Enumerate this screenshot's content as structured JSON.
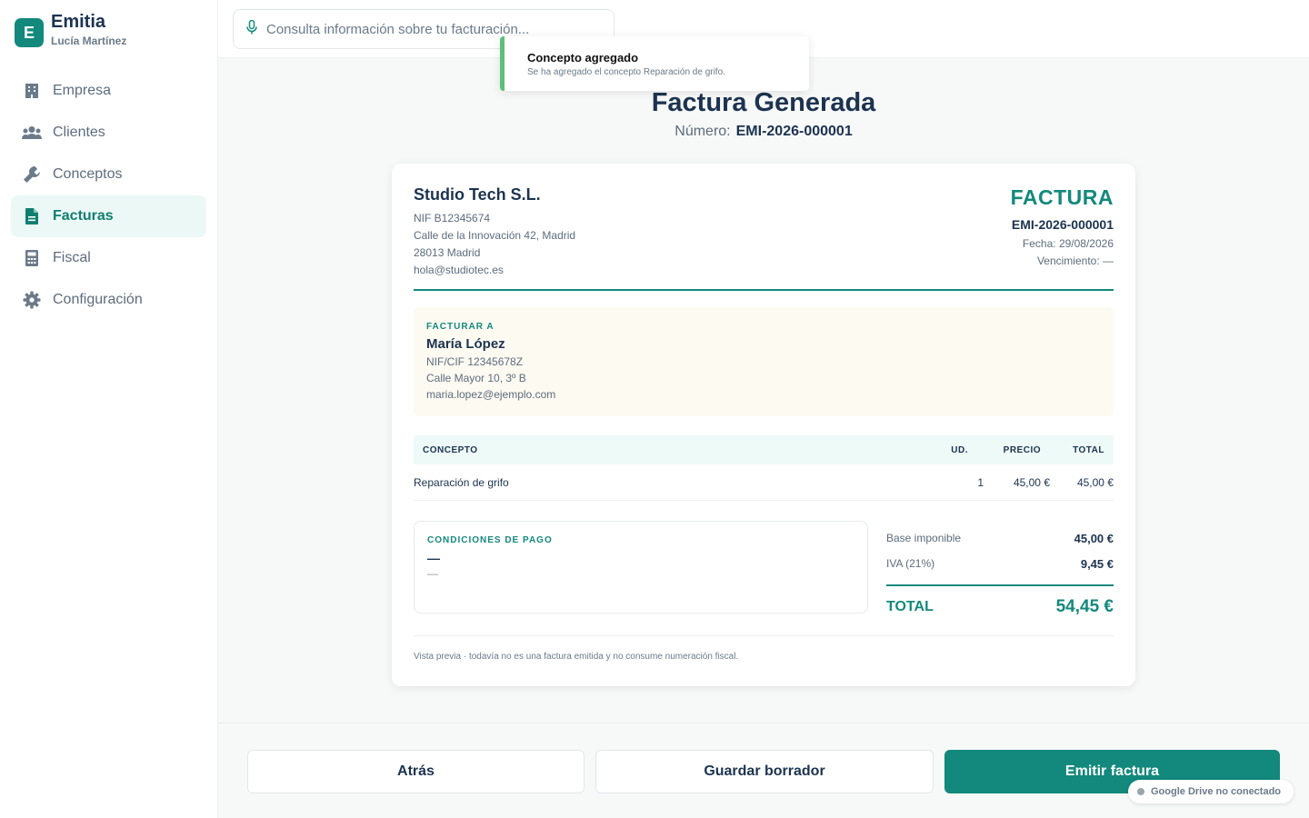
{
  "brand": {
    "logo_letter": "E",
    "name": "Emitia",
    "user": "Lucía Martínez",
    "accent": "#12897c"
  },
  "sidebar": {
    "items": [
      {
        "label": "Empresa",
        "icon": "building-icon"
      },
      {
        "label": "Clientes",
        "icon": "users-icon"
      },
      {
        "label": "Conceptos",
        "icon": "wrench-icon"
      },
      {
        "label": "Facturas",
        "icon": "document-icon",
        "active": true
      },
      {
        "label": "Fiscal",
        "icon": "calculator-icon"
      },
      {
        "label": "Configuración",
        "icon": "gear-icon"
      }
    ]
  },
  "search": {
    "placeholder": "Consulta información sobre tu facturación...",
    "icon": "microphone-icon"
  },
  "toast": {
    "title": "Concepto agregado",
    "message": "Se ha agregado el concepto Reparación de grifo.",
    "color": "#5cbf7a"
  },
  "header": {
    "title": "Factura Generada",
    "number_label": "Número:",
    "number": "EMI-2026-000001"
  },
  "invoice": {
    "issuer": {
      "name": "Studio Tech S.L.",
      "nif": "NIF B12345674",
      "address": "Calle de la Innovación 42, Madrid",
      "postal": "28013 Madrid",
      "email": "hola@studiotec.es"
    },
    "heading": "FACTURA",
    "number": "EMI-2026-000001",
    "date": "Fecha: 29/08/2026",
    "due": "Vencimiento: —",
    "client": {
      "label": "FACTURAR A",
      "name": "María López",
      "nif": "NIF/CIF 12345678Z",
      "address": "Calle Mayor 10, 3º B",
      "email": "maria.lopez@ejemplo.com"
    },
    "table": {
      "headers": {
        "concept": "CONCEPTO",
        "units": "UD.",
        "price": "PRECIO",
        "total": "TOTAL"
      },
      "rows": [
        {
          "concept": "Reparación de grifo",
          "units": "1",
          "price": "45,00 €",
          "total": "45,00 €"
        }
      ]
    },
    "conditions": {
      "label": "CONDICIONES DE PAGO",
      "main": "—",
      "sub": "—"
    },
    "totals": {
      "base_label": "Base imponible",
      "base": "45,00 €",
      "iva_label": "IVA (21%)",
      "iva": "9,45 €",
      "total_label": "TOTAL",
      "total": "54,45 €"
    },
    "note": "Vista previa · todavía no es una factura emitida y no consume numeración fiscal."
  },
  "footer": {
    "back": "Atrás",
    "draft": "Guardar borrador",
    "emit": "Emitir factura"
  },
  "drive_status": "Google Drive no conectado"
}
